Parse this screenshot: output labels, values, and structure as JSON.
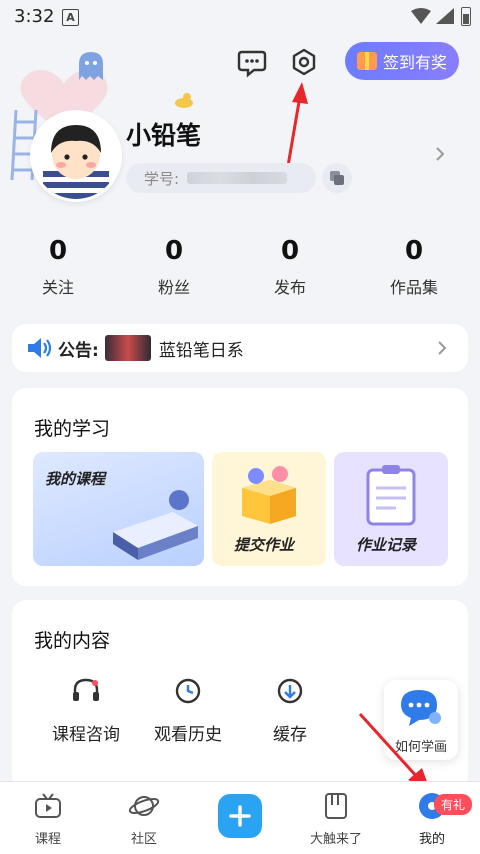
{
  "status_bar": {
    "time": "3:32",
    "notification_icon": "A"
  },
  "header": {
    "signin_label": "签到有奖",
    "username": "小铅笔",
    "id_label": "学号:"
  },
  "stats": [
    {
      "count": "0",
      "label": "关注"
    },
    {
      "count": "0",
      "label": "粉丝"
    },
    {
      "count": "0",
      "label": "发布"
    },
    {
      "count": "0",
      "label": "作品集"
    }
  ],
  "notice": {
    "label": "公告:",
    "text": "蓝铅笔日系"
  },
  "study": {
    "title": "我的学习",
    "tiles": [
      "我的课程",
      "提交作业",
      "作业记录"
    ]
  },
  "content": {
    "title": "我的内容",
    "items": [
      "课程咨询",
      "观看历史",
      "缓存"
    ]
  },
  "float_help": {
    "label": "如何学画"
  },
  "bottom_nav": {
    "items": [
      "课程",
      "社区",
      "大触来了",
      "我的"
    ],
    "badge": "有礼"
  },
  "colors": {
    "accent": "#29a3f2",
    "signin_gradient_start": "#6d7cff",
    "badge": "#ff4d5a",
    "arrow": "#e8262b"
  }
}
